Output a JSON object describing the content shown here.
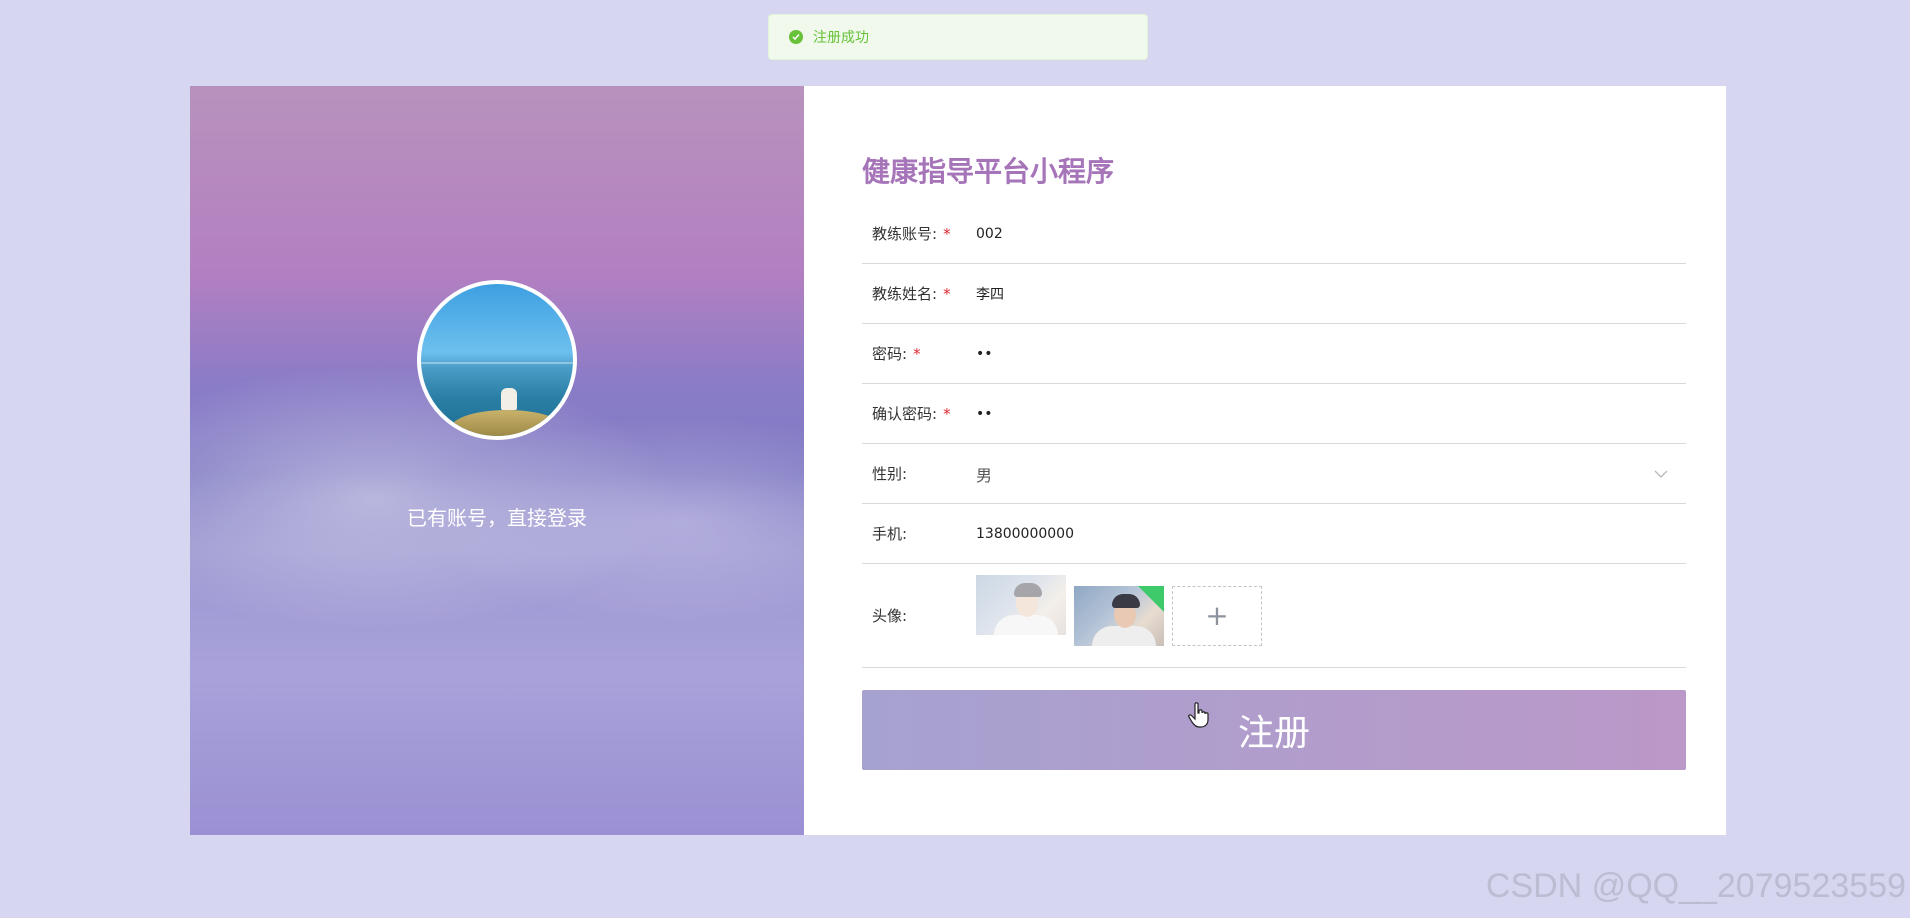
{
  "toast": {
    "message": "注册成功"
  },
  "left_panel": {
    "login_link": "已有账号，直接登录"
  },
  "form": {
    "title": "健康指导平台小程序",
    "fields": {
      "account": {
        "label": "教练账号:",
        "value": "002",
        "required": true
      },
      "name": {
        "label": "教练姓名:",
        "value": "李四",
        "required": true
      },
      "password": {
        "label": "密码:",
        "value": "••",
        "required": true
      },
      "confirm": {
        "label": "确认密码:",
        "value": "••",
        "required": true
      },
      "gender": {
        "label": "性别:",
        "value": "男"
      },
      "phone": {
        "label": "手机:",
        "value": "13800000000"
      },
      "avatar": {
        "label": "头像:",
        "add_symbol": "+"
      }
    },
    "required_mark": "*",
    "submit_label": "注册"
  },
  "watermark": "CSDN @QQ__2079523559",
  "colors": {
    "accent": "#a674b8",
    "success": "#67c23a",
    "background": "#d6d6f1"
  }
}
